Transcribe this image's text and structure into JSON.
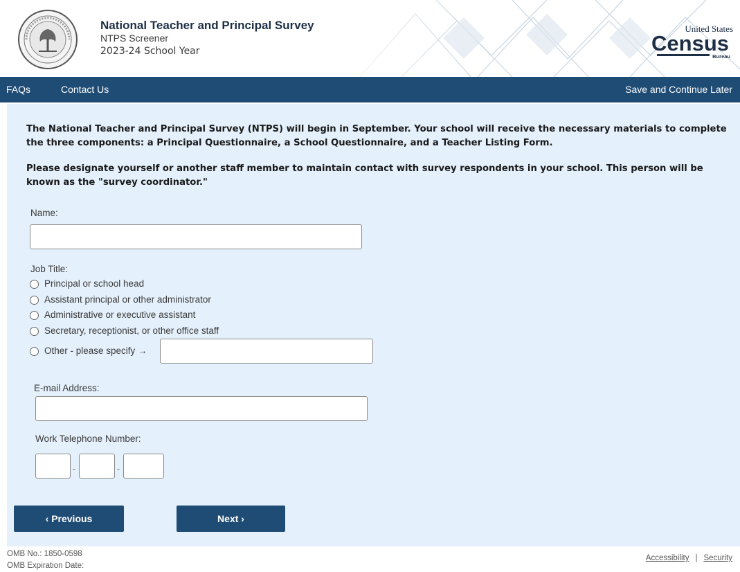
{
  "header": {
    "title": "National Teacher and Principal Survey",
    "subtitle": "NTPS Screener",
    "school_year": "2023-24 School Year",
    "seal_icon": "department-of-education-seal",
    "logo_icon": "census-bureau-logo",
    "logo_top_text": "United States",
    "logo_main_text": "Census",
    "logo_bottom_text": "Bureau"
  },
  "nav": {
    "faqs": "FAQs",
    "contact": "Contact Us",
    "save": "Save and Continue Later"
  },
  "main": {
    "intro_1": "The National Teacher and Principal Survey (NTPS) will begin in September. Your school will receive the necessary materials to complete the three components: a Principal Questionnaire, a School Questionnaire, and a Teacher Listing Form.",
    "intro_2": "Please designate yourself or another staff member to maintain contact with survey respondents in your school. This person will be known as the \"survey coordinator.\"",
    "name_label": "Name:",
    "name_value": "",
    "job_title_label": "Job Title:",
    "job_options": [
      "Principal or school head",
      "Assistant principal or other administrator",
      "Administrative or executive assistant",
      "Secretary, receptionist, or other office staff",
      "Other - please specify →"
    ],
    "other_specify_value": "",
    "email_label": "E-mail  Address:",
    "email_value": "",
    "phone_label": "Work Telephone Number:",
    "phone_separator": "-",
    "phone_area": "",
    "phone_prefix": "",
    "phone_line": ""
  },
  "buttons": {
    "previous": "‹ Previous",
    "next": "Next ›"
  },
  "footer": {
    "omb_number": "OMB No.: 1850-0598",
    "omb_expiration": "OMB Expiration Date:",
    "accessibility": "Accessibility",
    "separator": "|",
    "security": "Security"
  },
  "colors": {
    "nav_bg": "#1f4c74",
    "content_bg": "#e4f0fb",
    "button_bg": "#1f4c74"
  }
}
